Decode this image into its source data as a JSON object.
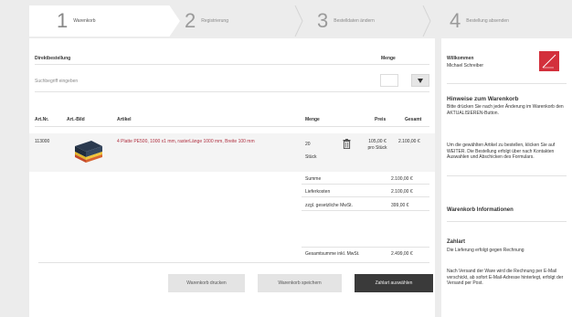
{
  "steps": [
    {
      "num": "1",
      "label": "Warenkorb"
    },
    {
      "num": "2",
      "label": "Registrierung"
    },
    {
      "num": "3",
      "label": "Bestelldaten ändern"
    },
    {
      "num": "4",
      "label": "Bestellung absenden"
    }
  ],
  "quick_order": {
    "title": "Direktbestellung",
    "qty_header": "Menge",
    "placeholder": "Suchbegriff eingeben",
    "add_icon": "dropdown-arrow-icon"
  },
  "table": {
    "headers": [
      "Art.Nr.",
      "Art.-Bild",
      "Artikel",
      "Menge",
      "Preis",
      "Gesamt"
    ],
    "rows": [
      {
        "art_nr": "113000",
        "article": "4 Platte PE500, 1000 x1 mm, rasterLänge 1000 mm, Breite 100 mm",
        "qty": "20",
        "unit": "Stück",
        "price": "105,00 €",
        "price_unit": "pro Stück",
        "total": "2.100,00 €"
      }
    ]
  },
  "summary": [
    {
      "label": "Summe",
      "value": "2.100,00 €"
    },
    {
      "label": "Lieferkosten",
      "value": "2.100,00 €"
    },
    {
      "label": "zzgl. gesetzliche MwSt.",
      "value": "399,00 €"
    }
  ],
  "grand_total": {
    "label": "Gesamtsumme inkl. MwSt.",
    "value": "2.499,00 €"
  },
  "buttons": {
    "print": "Warenkorb drucken",
    "save": "Warenkorb speichern",
    "checkout": "Zahlart auswählen"
  },
  "sidebar": {
    "welcome": "Willkommen",
    "name": "Michael Schreiber",
    "hint_title": "Hinweise zum Warenkorb",
    "hint_text_1": "Bitte drücken Sie nach jeder Änderung im Warenkorb den AKTUALISIEREN-Button.",
    "hint_text_2": "Um die gewählten Artikel zu bestellen, klicken Sie auf WEITER. Die Bestellung erfolgt über nach Kontakten Auswahlen und Abschicken des Formulars.",
    "info_title": "Warenkorb Informationen",
    "pay_title": "Zahlart",
    "pay_sub": "Die Lieferung erfolgt gegen Rechnung",
    "pay_text": "Nach Versand der Ware wird die Rechnung per E-Mail verschickt, ab sofort E-Mail-Adresse hinterlegt, erfolgt der Versand per Post."
  },
  "colors": {
    "accent": "#d3303c",
    "dark_button": "#3a3a3a"
  }
}
